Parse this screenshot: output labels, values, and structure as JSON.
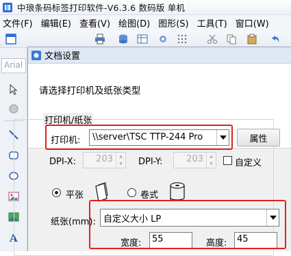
{
  "window": {
    "title": "中琅条码标签打印软件-V6.3.6 数码版 单机"
  },
  "menubar": {
    "items": [
      "文件(F)",
      "编辑(E)",
      "查看(V)",
      "绘图(D)",
      "图形(S)",
      "工具(T)",
      "窗口(W)"
    ]
  },
  "left_toolbar": {
    "font_name": "Arial"
  },
  "dialog": {
    "title": "文档设置",
    "prompt": "请选择打印机及纸张类型",
    "group_title": "打印机/纸张",
    "printer_label": "打印机:",
    "printer_value": "\\\\server\\TSC TTP-244 Pro",
    "properties_button": "属性",
    "dpi_x_label": "DPI-X:",
    "dpi_x_value": "203",
    "dpi_y_label": "DPI-Y:",
    "dpi_y_value": "203",
    "custom_label": "自定义",
    "sheet_label": "平张",
    "roll_label": "卷式",
    "sheet_selected": true,
    "paper_label": "纸张(mm):",
    "paper_value": "自定义大小 LP",
    "width_label": "宽度:",
    "width_value": "55",
    "height_label": "高度:",
    "height_value": "45"
  },
  "colors": {
    "highlight": "#e02020",
    "title_bar": "#dfe8f4"
  }
}
